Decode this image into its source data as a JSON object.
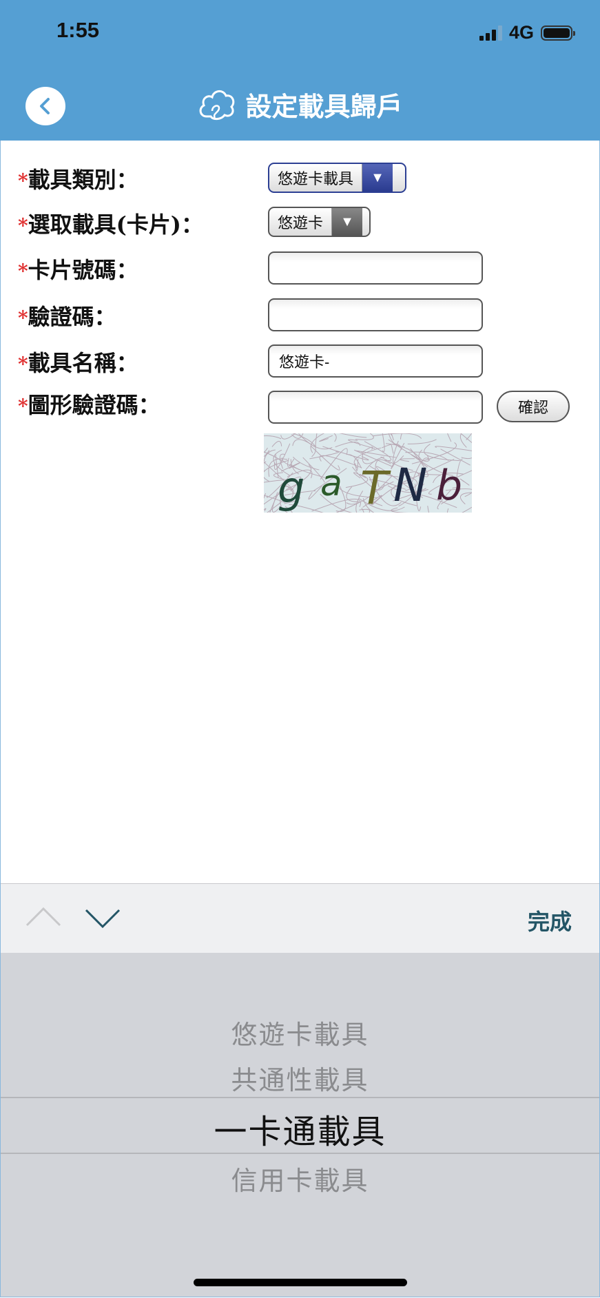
{
  "status_bar": {
    "time": "1:55",
    "network": "4G",
    "battery_icon": "battery-full-icon",
    "signal_icon": "signal-icon"
  },
  "header": {
    "title": "設定載具歸戶",
    "back_icon": "chevron-left-icon",
    "logo_icon": "cloud-logo-icon",
    "color": "#559fd3"
  },
  "form": {
    "required_mark": "*",
    "carrier_type": {
      "label": "載具類別：",
      "value": "悠遊卡載具"
    },
    "select_carrier": {
      "label": "選取載具(卡片)：",
      "value": "悠遊卡"
    },
    "card_number": {
      "label": "卡片號碼：",
      "value": ""
    },
    "verify_code": {
      "label": "驗證碼：",
      "value": ""
    },
    "carrier_name": {
      "label": "載具名稱：",
      "value": "悠遊卡-"
    },
    "captcha_code": {
      "label": "圖形驗證碼：",
      "value": "",
      "confirm_label": "確認",
      "captcha_text": "gaTNb"
    }
  },
  "keyboard_toolbar": {
    "prev_icon": "chevron-up-icon",
    "next_icon": "chevron-down-icon",
    "done_label": "完成"
  },
  "picker": {
    "options": [
      "悠遊卡載具",
      "共通性載具",
      "一卡通載具",
      "信用卡載具"
    ],
    "selected": "一卡通載具"
  }
}
